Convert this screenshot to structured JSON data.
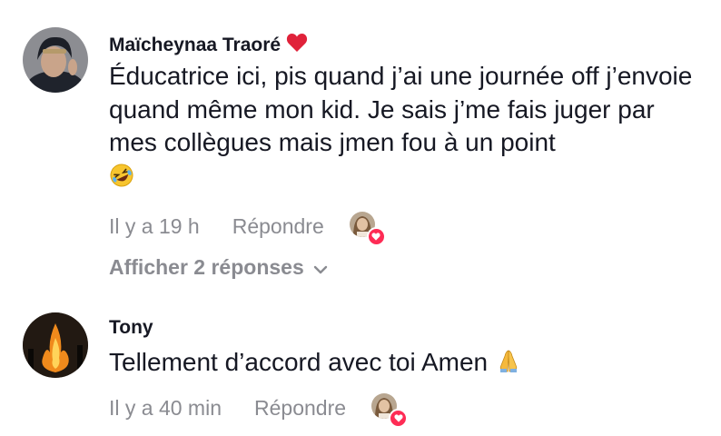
{
  "comments": [
    {
      "username": "Maïcheynaa Traoré",
      "badge_icon": "heart-icon",
      "text": "Éducatrice ici, pis quand j’ai une journée off j’envoie quand même mon kid. Je sais j’me fais juger par mes collègues mais jmen fou à un point",
      "emoji_icon": "rolling-on-floor-laughing-emoji",
      "time": "Il y a 19 h",
      "reply_label": "Répondre",
      "replies_label": "Afficher 2 réponses"
    },
    {
      "username": "Tony",
      "text": "Tellement d’accord avec toi Amen",
      "emoji_icon": "folded-hands-emoji",
      "time": "Il y a 40 min",
      "reply_label": "Répondre"
    }
  ],
  "colors": {
    "text": "#161823",
    "secondary": "#8a8b91",
    "heart": "#e0223a",
    "like_badge": "#fe2c55"
  }
}
